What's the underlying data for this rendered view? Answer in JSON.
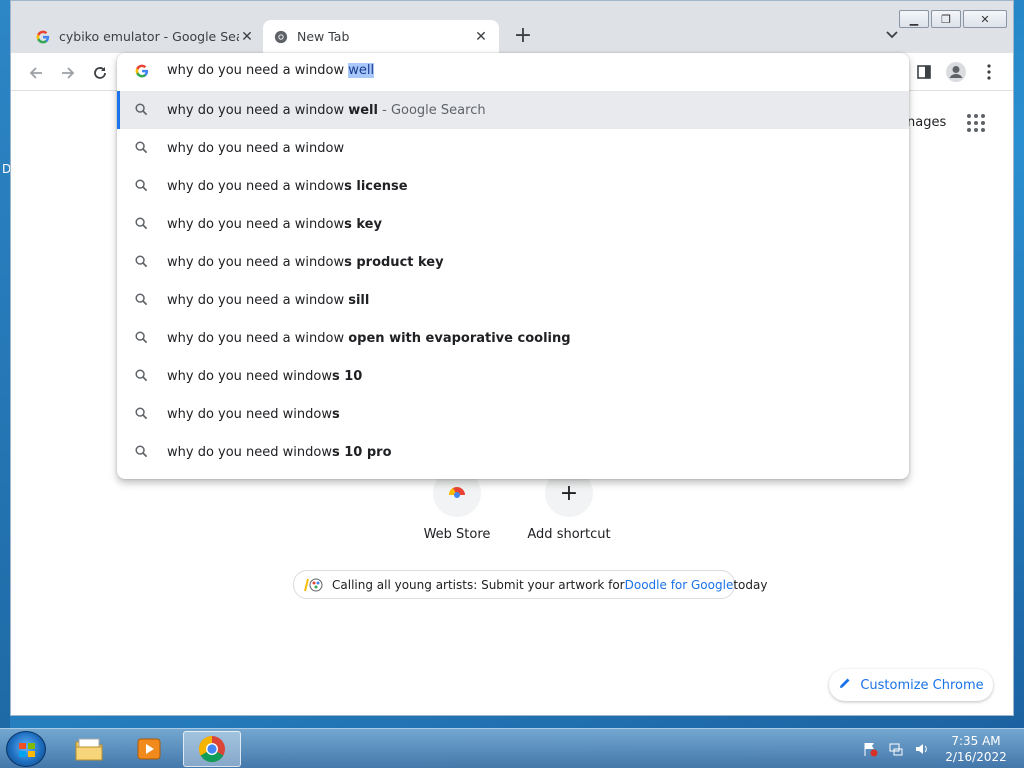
{
  "desktop": {
    "edge_letter": "D"
  },
  "tabs": [
    {
      "title": "cybiko emulator - Google Search",
      "favicon": "google-g-icon",
      "active": false
    },
    {
      "title": "New Tab",
      "favicon": "chrome-icon",
      "active": true
    }
  ],
  "toolbar": {
    "back_icon": "back-arrow-icon",
    "forward_icon": "forward-arrow-icon",
    "reload_icon": "reload-icon"
  },
  "omnibox": {
    "typed_text": "why do you need a window ",
    "selected_completion": "well",
    "suggestions": [
      {
        "plain": "why do you need a window ",
        "bold": "well",
        "suffix": " - Google Search",
        "highlighted": true
      },
      {
        "plain": "why do you need a window",
        "bold": "",
        "suffix": "",
        "highlighted": false
      },
      {
        "plain": "why do you need a window",
        "bold": "s license",
        "suffix": "",
        "highlighted": false
      },
      {
        "plain": "why do you need a window",
        "bold": "s key",
        "suffix": "",
        "highlighted": false
      },
      {
        "plain": "why do you need a window",
        "bold": "s product key",
        "suffix": "",
        "highlighted": false
      },
      {
        "plain": "why do you need a window ",
        "bold": "sill",
        "suffix": "",
        "highlighted": false
      },
      {
        "plain": "why do you need a window ",
        "bold": "open with evaporative cooling",
        "suffix": "",
        "highlighted": false
      },
      {
        "plain": "why do you need window",
        "bold": "s 10",
        "suffix": "",
        "highlighted": false
      },
      {
        "plain": "why do you need window",
        "bold": "s",
        "suffix": "",
        "highlighted": false
      },
      {
        "plain": "why do you need window",
        "bold": "s 10 pro",
        "suffix": "",
        "highlighted": false
      }
    ]
  },
  "ntp": {
    "images_link": "nages",
    "shortcuts": [
      {
        "label": "Web Store",
        "icon": "web-store-icon"
      },
      {
        "label": "Add shortcut",
        "icon": "plus-icon"
      }
    ],
    "promo": {
      "text_before": "Calling all young artists: Submit your artwork for ",
      "link": "Doodle for Google",
      "text_after": " today"
    },
    "customize_label": "Customize Chrome"
  },
  "taskbar": {
    "items": [
      {
        "name": "explorer",
        "icon": "folder-icon",
        "active": false
      },
      {
        "name": "media-player",
        "icon": "media-player-icon",
        "active": false
      },
      {
        "name": "chrome",
        "icon": "chrome-icon",
        "active": true
      }
    ],
    "clock_time": "7:35 AM",
    "clock_date": "2/16/2022"
  },
  "colors": {
    "accent": "#1a73e8",
    "tabstrip": "#dee1e6",
    "highlight_row": "#e8eaed",
    "selection": "#a8c7fa"
  }
}
